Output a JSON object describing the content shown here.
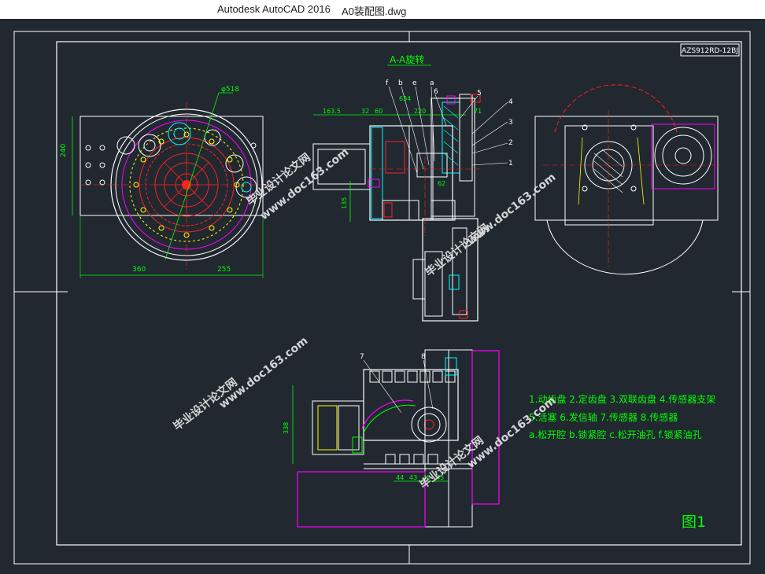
{
  "window": {
    "app_title": "Autodesk AutoCAD 2016",
    "document_title": "A0装配图.dwg"
  },
  "drawing": {
    "title_block_code": "AZS912RD-12BJ",
    "section_title": "A-A旋转",
    "figure_label": "图1",
    "legend": [
      "1.动齿盘 2.定齿盘 3.双联齿盘 4.传感器支架",
      "5.活塞 6.发信轴  7.传感器 8.传感器",
      "a.松开腔 b.锁紧腔  c.松开油孔 f.锁紧油孔"
    ],
    "dims_front": {
      "height": "240",
      "left": "360",
      "right": "255",
      "diameter": "φ518"
    },
    "dims_section": {
      "d1": "163.5",
      "d2": "32",
      "d3": "60",
      "d4": "220",
      "d5": "71",
      "d6": "634",
      "d7": "135",
      "d8": "62"
    },
    "dims_bottom": {
      "height": "338",
      "b1": "44",
      "b2": "43",
      "b3": "45",
      "b4": "45"
    },
    "section_letters": [
      "f",
      "b",
      "e",
      "a"
    ],
    "balloons_section": [
      "6",
      "5",
      "4",
      "3",
      "2",
      "1"
    ],
    "balloons_bottom": [
      "7",
      "8"
    ],
    "watermarks": [
      "毕业设计论文网",
      "www.doc163.com"
    ],
    "colors": {
      "background": "#212830",
      "border": "#ffffff",
      "green": "#00ff00",
      "cyan": "#00ffff",
      "red": "#ff2020",
      "magenta": "#ff00ff",
      "yellow": "#ffff00",
      "watermark": "#e8e8e8"
    }
  }
}
